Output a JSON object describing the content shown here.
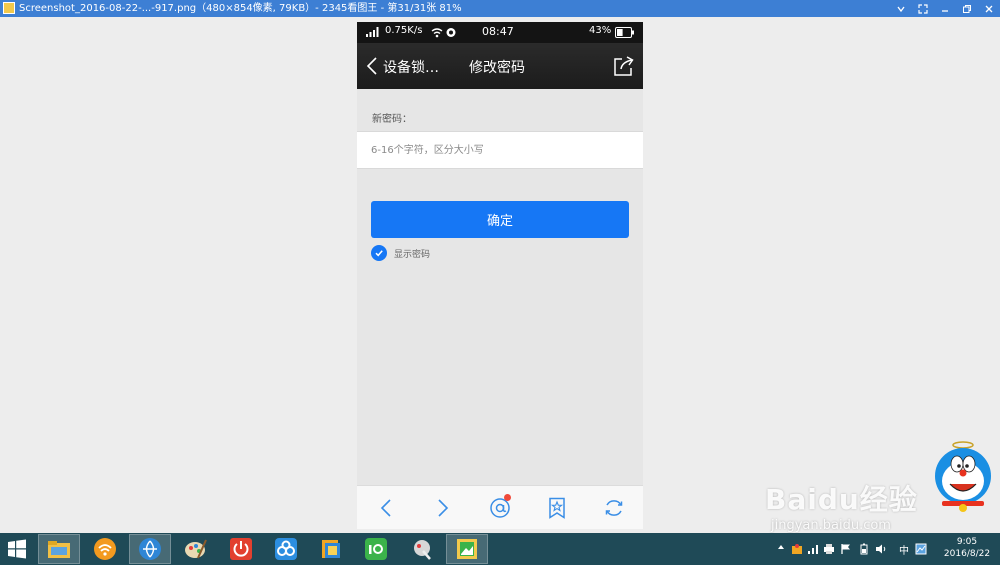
{
  "viewer": {
    "title": "Screenshot_2016-08-22-...-917.png（480×854像素, 79KB）- 2345看图王 - 第31/31张 81%"
  },
  "phone": {
    "status_bar": {
      "network_speed": "0.75K/s",
      "time": "08:47",
      "battery_percent": "43%",
      "battery_level": 0.43
    },
    "nav_bar": {
      "back_label": "设备锁…",
      "page_title": "修改密码"
    },
    "form": {
      "hint": "新密码：",
      "password_placeholder": "6-16个字符，区分大小写",
      "confirm_label": "确定",
      "show_password_label": "显示密码",
      "show_password_checked": true
    },
    "accent_color": "#1677f5",
    "toolbar": {
      "icons": [
        "chevron-left-icon",
        "chevron-right-icon",
        "at-mention-icon",
        "bookmark-star-icon",
        "refresh-icon"
      ],
      "notification_dot": true
    }
  },
  "watermark": {
    "brand": "Baidu经验",
    "url": "jingyan.baidu.com"
  },
  "taskbar": {
    "apps": [
      "file-explorer-icon",
      "wifi-sharing-icon",
      "browser-icon",
      "paint-icon",
      "power-icon",
      "cloud-sync-icon",
      "folder-icon",
      "iqiyi-icon",
      "screenshot-tool-icon",
      "image-viewer-icon"
    ],
    "tray": {
      "ime": "中",
      "time": "9:05",
      "date": "2016/8/22"
    }
  }
}
